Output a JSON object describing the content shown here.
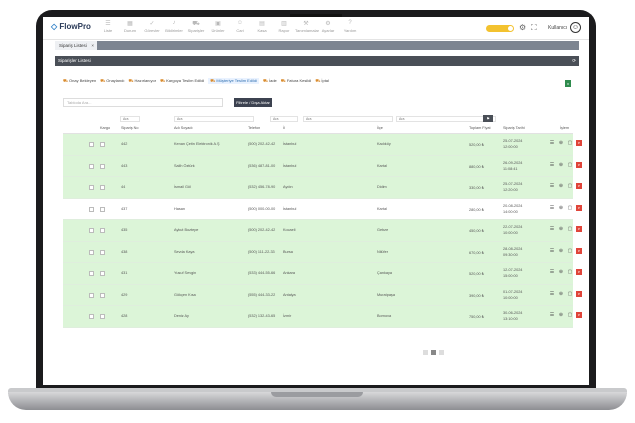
{
  "app": {
    "name": "FlowPro",
    "user": "Kullanıcı"
  },
  "nav": [
    {
      "label": "Liste",
      "icon": "list-icon"
    },
    {
      "label": "Durum",
      "icon": "grid-icon"
    },
    {
      "label": "Görevler",
      "icon": "task-icon"
    },
    {
      "label": "Bildirimler",
      "icon": "bell-icon"
    },
    {
      "label": "Siparişler",
      "icon": "cart-icon"
    },
    {
      "label": "Ürünler",
      "icon": "box-icon"
    },
    {
      "label": "Cari",
      "icon": "user-icon"
    },
    {
      "label": "Kasa",
      "icon": "wallet-icon"
    },
    {
      "label": "Rapor",
      "icon": "chart-icon"
    },
    {
      "label": "Tanımlamalar",
      "icon": "settings-icon"
    },
    {
      "label": "Ayarlar",
      "icon": "gear-icon"
    },
    {
      "label": "Yardım",
      "icon": "help-icon"
    }
  ],
  "tab": {
    "label": "Sipariş Listesi"
  },
  "panel": {
    "title": "Siparişler Listesi"
  },
  "toolbar": [
    {
      "label": "Onay Bekleyen",
      "active": false
    },
    {
      "label": "Onaylandı",
      "active": false
    },
    {
      "label": "Hazırlanıyor",
      "active": false
    },
    {
      "label": "Kargoya Teslim Edildi",
      "active": false
    },
    {
      "label": "Müşteriye Teslim Edildi",
      "active": true
    },
    {
      "label": "İade",
      "active": false
    },
    {
      "label": "Fatura Kesildi",
      "active": false
    },
    {
      "label": "İptal",
      "active": false
    }
  ],
  "search": {
    "placeholder": "Tabloda Ara..."
  },
  "bulk_button": "Filtrele / Dışa Aktar",
  "filters": [
    "Ara",
    "Ara",
    "Ara",
    "Ara",
    "Ara"
  ],
  "columns": [
    "Kargo",
    "Sipariş No",
    "Adı Soyadı",
    "Telefon",
    "İl",
    "İlçe",
    "Toplam Fiyat",
    "Sipariş Tarihi",
    "İşlem"
  ],
  "rows": [
    {
      "no": "442",
      "name": "Kenan Çetin Elektronik A.Ş",
      "phone": "(500) 202-42-42",
      "city": "İstanbul",
      "district": "Kadıköy",
      "total": "520,00 ₺",
      "date": "25-07-2024",
      "time": "12:00:00",
      "green": true
    },
    {
      "no": "443",
      "name": "Salih Öztürk",
      "phone": "(536) 487-81-00",
      "city": "İstanbul",
      "district": "Kartal",
      "total": "880,00 ₺",
      "date": "26-09-2024",
      "time": "11:08:41",
      "green": true
    },
    {
      "no": "44",
      "name": "İsmail Göl",
      "phone": "(532) 456-78-90",
      "city": "Aydın",
      "district": "Didim",
      "total": "330,00 ₺",
      "date": "25-07-2024",
      "time": "12:20:00",
      "green": true
    },
    {
      "no": "437",
      "name": "Hasan",
      "phone": "(500) 000-00-00",
      "city": "İstanbul",
      "district": "Kartal",
      "total": "280,00 ₺",
      "date": "20-08-2024",
      "time": "14:00:00",
      "green": false
    },
    {
      "no": "435",
      "name": "Aykut Boztepe",
      "phone": "(500) 202-42-42",
      "city": "Kocaeli",
      "district": "Gebze",
      "total": "450,00 ₺",
      "date": "22-07-2024",
      "time": "10:00:00",
      "green": true
    },
    {
      "no": "438",
      "name": "Sevda Kaya",
      "phone": "(500) 111-22-33",
      "city": "Bursa",
      "district": "Nilüfer",
      "total": "670,00 ₺",
      "date": "28-08-2024",
      "time": "09:30:00",
      "green": true
    },
    {
      "no": "431",
      "name": "Yusuf Sevgin",
      "phone": "(533) 444-55-66",
      "city": "Ankara",
      "district": "Çankaya",
      "total": "520,00 ₺",
      "date": "12-07-2024",
      "time": "15:00:00",
      "green": true
    },
    {
      "no": "429",
      "name": "Gökçen Kısa",
      "phone": "(555) 444-33-22",
      "city": "Antalya",
      "district": "Muratpaşa",
      "total": "390,00 ₺",
      "date": "01-07-2024",
      "time": "10:00:00",
      "green": true
    },
    {
      "no": "428",
      "name": "Deniz Ay",
      "phone": "(532) 132-43-65",
      "city": "İzmir",
      "district": "Bornova",
      "total": "750,00 ₺",
      "date": "30-06-2024",
      "time": "13:10:00",
      "green": true
    }
  ]
}
